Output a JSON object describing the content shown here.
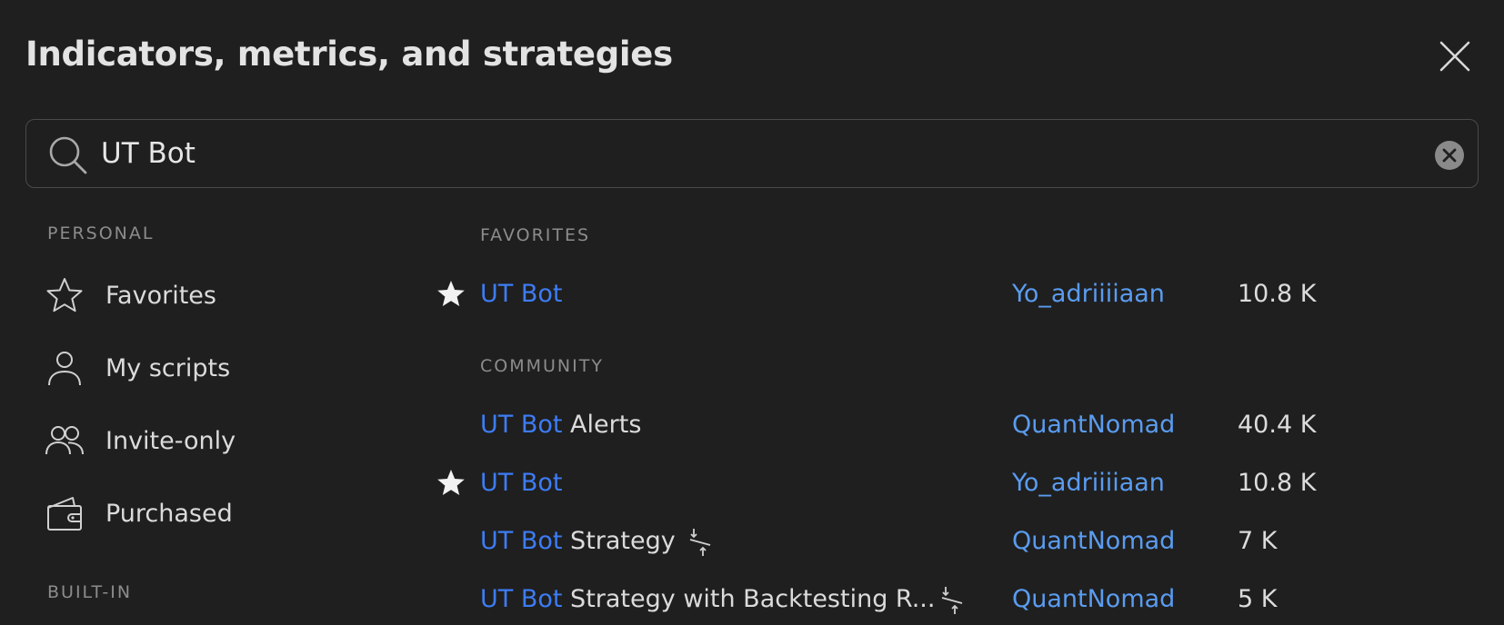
{
  "dialog": {
    "title": "Indicators, metrics, and strategies",
    "close_icon": "close-icon"
  },
  "search": {
    "value": "UT Bot",
    "icon": "search-icon",
    "clear_icon": "clear-icon"
  },
  "sidebar": {
    "personal_header": "PERSONAL",
    "items": [
      {
        "label": "Favorites",
        "icon": "star-outline-icon"
      },
      {
        "label": "My scripts",
        "icon": "user-icon"
      },
      {
        "label": "Invite-only",
        "icon": "users-icon"
      },
      {
        "label": "Purchased",
        "icon": "wallet-icon"
      }
    ],
    "builtin_header": "BUILT-IN"
  },
  "results": {
    "favorites_header": "FAVORITES",
    "favorites": [
      {
        "highlight": "UT Bot",
        "rest": "",
        "author": "Yo_adriiiiaan",
        "count": "10.8 K",
        "starred": true
      }
    ],
    "community_header": "COMMUNITY",
    "community": [
      {
        "highlight": "UT Bot",
        "rest": " Alerts",
        "author": "QuantNomad",
        "count": "40.4 K",
        "starred": false,
        "strategy": false
      },
      {
        "highlight": "UT Bot",
        "rest": "",
        "author": "Yo_adriiiiaan",
        "count": "10.8 K",
        "starred": true,
        "strategy": false
      },
      {
        "highlight": "UT Bot",
        "rest": " Strategy",
        "author": "QuantNomad",
        "count": "7 K",
        "starred": false,
        "strategy": true
      },
      {
        "highlight": "UT Bot",
        "rest": " Strategy with Backtesting R...",
        "author": "QuantNomad",
        "count": "5 K",
        "starred": false,
        "strategy": true
      }
    ]
  },
  "colors": {
    "background": "#1f1f1f",
    "highlight": "#3d7cf5",
    "author_link": "#5a9cf0",
    "text": "#dbdbdb",
    "muted": "#8c8c8c"
  }
}
